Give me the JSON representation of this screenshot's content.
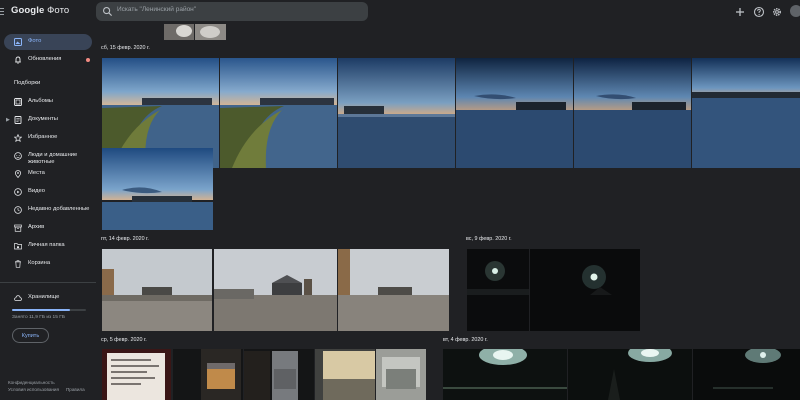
{
  "app": {
    "logo_brand": "Google",
    "logo_product": "Фото"
  },
  "search": {
    "placeholder": "Искать \"Ленинский район\""
  },
  "topbar_icons": [
    "add-icon",
    "help-icon",
    "settings-icon"
  ],
  "sidebar": {
    "photos": "Фото",
    "updates": "Обновления",
    "collections_title": "Подборки",
    "items": [
      {
        "label": "Альбомы",
        "icon": "album-icon"
      },
      {
        "label": "Документы",
        "icon": "document-icon"
      },
      {
        "label": "Избранное",
        "icon": "star-icon"
      },
      {
        "label": "Люди и домашние\nживотные",
        "icon": "people-icon"
      },
      {
        "label": "Места",
        "icon": "place-icon"
      },
      {
        "label": "Видео",
        "icon": "video-icon"
      },
      {
        "label": "Недавно добавленные",
        "icon": "recent-icon"
      },
      {
        "label": "Архив",
        "icon": "archive-icon"
      },
      {
        "label": "Личная папка",
        "icon": "locked-folder-icon"
      },
      {
        "label": "Корзина",
        "icon": "trash-icon"
      }
    ],
    "storage": {
      "label": "Хранилище",
      "used_text": "Занято 11,9 ГБ из 15 ГБ",
      "used_fraction": 0.79,
      "buy_label": "Купить"
    },
    "footer": {
      "privacy": "Конфиденциальность",
      "terms": "Условия использования",
      "policy": "Правила"
    }
  },
  "groups": {
    "d1": "сб, 15 февр. 2020 г.",
    "d2": "пт, 14 февр. 2020 г.",
    "d3": "вс, 9 февр. 2020 г.",
    "d4": "ср, 5 февр. 2020 г.",
    "d5": "вт, 4 февр. 2020 г."
  },
  "colors": {
    "background": "#202124",
    "accent": "#8ab4f8",
    "active_nav": "#394457",
    "notification": "#f28b82"
  }
}
